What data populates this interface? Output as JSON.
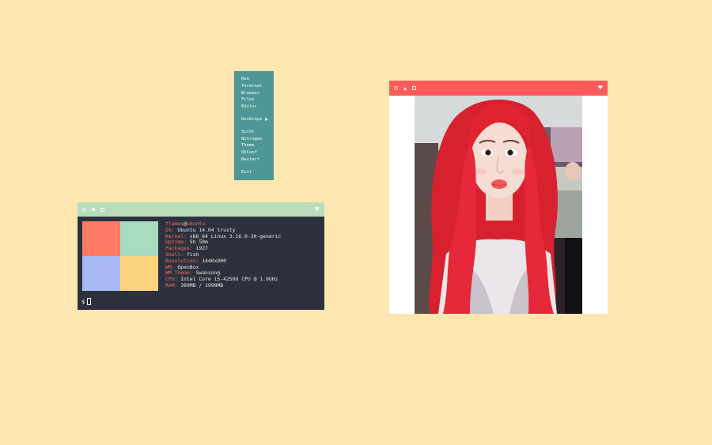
{
  "menu": {
    "group1": [
      "Run",
      "Terminal",
      "Browser",
      "Files",
      "Editor"
    ],
    "desktops": "Desktops",
    "group2": [
      "Scrot",
      "Nitrogen",
      "Theme",
      "ObConf",
      "Restart"
    ],
    "exit": "Exit"
  },
  "terminal": {
    "user": "flames",
    "at": "@",
    "host": "ubuntu",
    "info": [
      {
        "key": "OS:",
        "value": "Ubuntu 14.04 trusty"
      },
      {
        "key": "Kernel:",
        "value": "x86_64 Linux 3.16.0-30-generic"
      },
      {
        "key": "Uptime:",
        "value": "5h 59m"
      },
      {
        "key": "Packages:",
        "value": "1927"
      },
      {
        "key": "Shell:",
        "value": "fish"
      },
      {
        "key": "Resolution:",
        "value": "1440x900"
      },
      {
        "key": "WM:",
        "value": "OpenBox"
      },
      {
        "key": "WM Theme:",
        "value": "Swansong"
      },
      {
        "key": "CPU:",
        "value": "Intel Core i5-4250U CPU @ 1.9GHz"
      },
      {
        "key": "RAM:",
        "value": "360MB / 1998MB"
      }
    ],
    "prompt": "$",
    "swatches": [
      "#ff7b63",
      "#a7dcc1",
      "#a8b9f6",
      "#fdd47e"
    ]
  },
  "icons": {
    "close": "circle",
    "maximize": "triangle",
    "iconify": "square",
    "heart": "heart"
  },
  "colors": {
    "desktop": "#fde6b0",
    "menu": "#4f9696",
    "terminal_titlebar": "#b9dcbb",
    "terminal_bg": "#2d313d",
    "viewer_titlebar": "#fb5c5a",
    "accent": "#f0705f"
  }
}
